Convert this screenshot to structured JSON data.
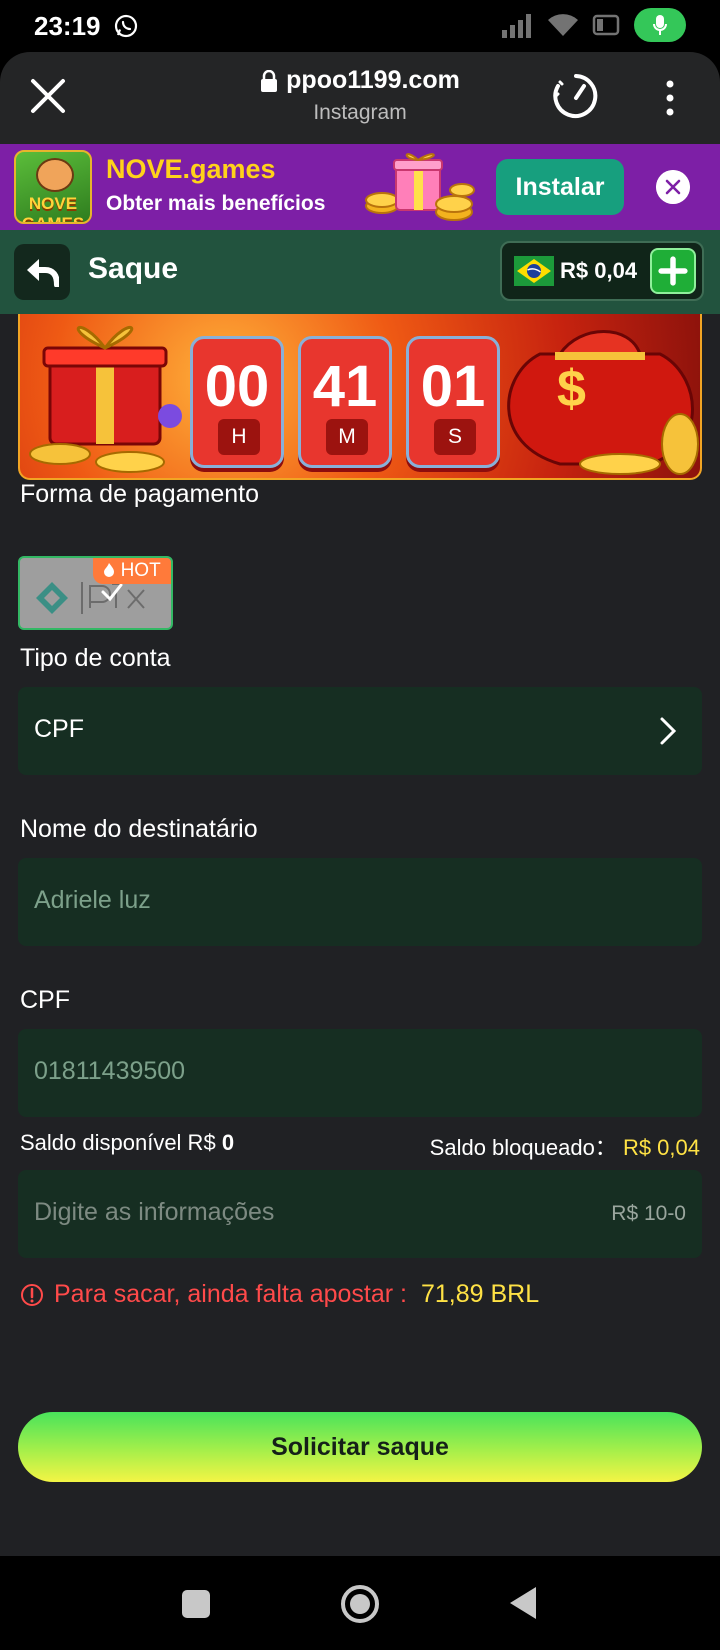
{
  "status_bar": {
    "time": "23:19"
  },
  "browser": {
    "domain": "ppoo1199.com",
    "source": "Instagram"
  },
  "install_banner": {
    "title": "NOVE.games",
    "subtitle": "Obter mais benefícios",
    "install_label": "Instalar",
    "logo_text": "NOVE GAMES"
  },
  "header": {
    "title": "Saque",
    "balance": "R$ 0,04"
  },
  "promo_timer": {
    "hours": "00",
    "hours_label": "H",
    "minutes": "41",
    "minutes_label": "M",
    "seconds": "01",
    "seconds_label": "S"
  },
  "form": {
    "payment_label": "Forma de pagamento",
    "payment_badge": "HOT",
    "payment_method_text": "pix",
    "account_type_label": "Tipo de conta",
    "account_type_value": "CPF",
    "recipient_label": "Nome do destinatário",
    "recipient_placeholder": "Adriele luz",
    "cpf_label": "CPF",
    "cpf_placeholder": "01811439500",
    "available_label": "Saldo disponível R$",
    "available_value": "0",
    "blocked_label": "Saldo bloqueado：",
    "blocked_value": "R$ 0,04",
    "amount_placeholder": "Digite as informações",
    "amount_range": "R$ 10-0",
    "warning_text": "Para sacar, ainda falta apostar :",
    "warning_amount": "71,89 BRL",
    "submit_label": "Solicitar saque"
  },
  "colors": {
    "accent_green": "#22533e",
    "field_bg": "#162e22",
    "warning": "#ff4a4a",
    "highlight": "#ffe245"
  }
}
